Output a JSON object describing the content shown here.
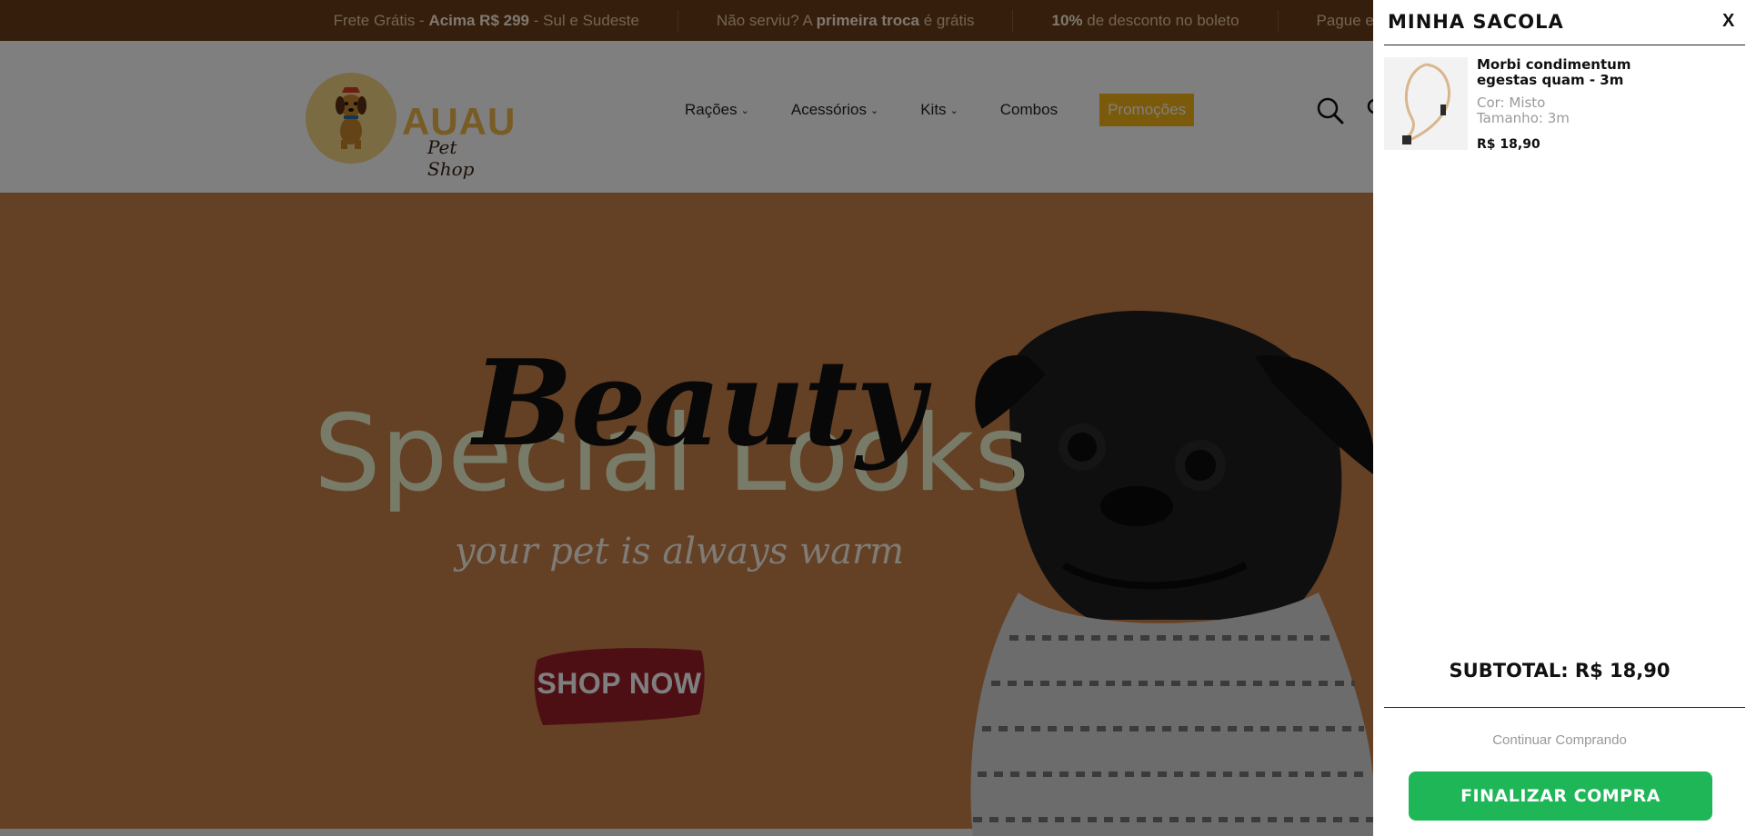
{
  "announcement": {
    "m1_pre": "Frete Grátis - ",
    "m1_bold": "Acima R$ 299",
    "m1_post": " - Sul e Sudeste",
    "m2_pre": "Não serviu? A ",
    "m2_bold": "primeira troca",
    "m2_post": " é grátis",
    "m3_bold": "10%",
    "m3_post": " de desconto no boleto",
    "m4_pre": "Pague em até"
  },
  "header": {
    "logo_word": "AUAU",
    "logo_sub": "Pet Shop",
    "nav": [
      "Rações",
      "Acessórios",
      "Kits",
      "Combos"
    ],
    "promo_label": "Promoções"
  },
  "hero": {
    "title_script": "Beauty",
    "title_main": "Special Looks",
    "subtitle": "your pet is always warm",
    "cta_label": "SHOP NOW"
  },
  "cart": {
    "title": "MINHA SACOLA",
    "close_label": "X",
    "item": {
      "name": "Morbi condimentum egestas quam - 3m",
      "color_label": "Cor: Misto",
      "size_label": "Tamanho: 3m",
      "price": "R$ 18,90"
    },
    "subtotal": "SUBTOTAL: R$ 18,90",
    "continue_label": "Continuar Comprando",
    "checkout_label": "FINALIZAR COMPRA"
  },
  "colors": {
    "topbar_bg": "#6b3d16",
    "hero_bg": "#c9814a",
    "promo_bg": "#f6b716",
    "checkout_bg": "#1fb657",
    "overlay": "rgba(0,0,0,0.5)"
  }
}
